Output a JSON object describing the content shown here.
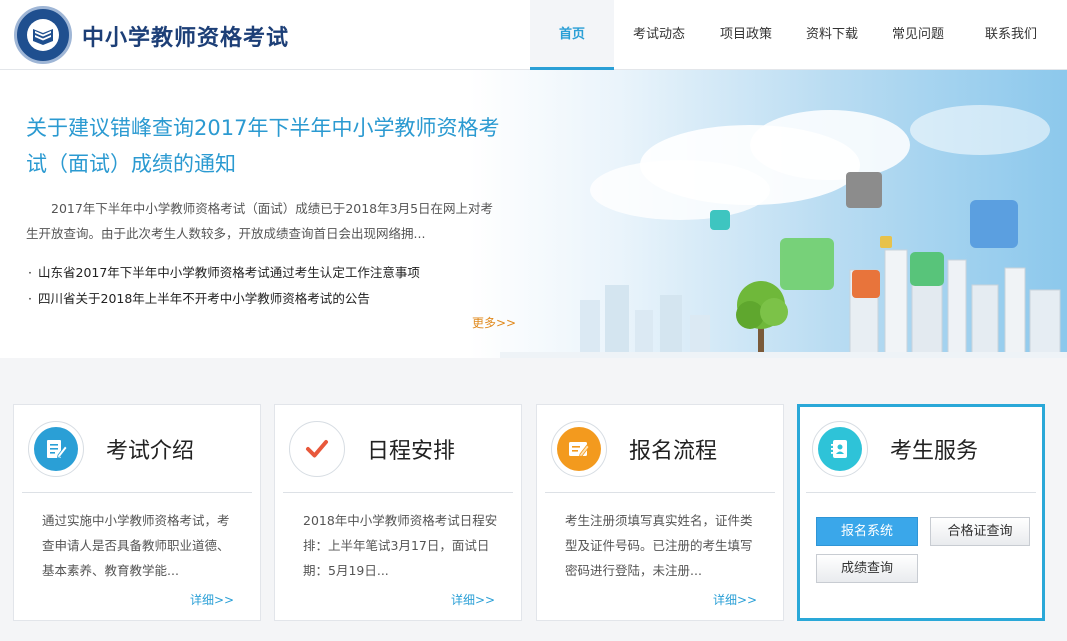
{
  "header": {
    "site_title": "中小学教师资格考试",
    "nav": [
      "首页",
      "考试动态",
      "项目政策",
      "资料下载",
      "常见问题",
      "联系我们"
    ],
    "active_nav": "首页"
  },
  "banner": {
    "headline": "关于建议错峰查询2017年下半年中小学教师资格考试（面试）成绩的通知",
    "summary": "2017年下半年中小学教师资格考试（面试）成绩已于2018年3月5日在网上对考生开放查询。由于此次考生人数较多，开放成绩查询首日会出现网络拥...",
    "news": [
      "山东省2017年下半年中小学教师资格考试通过考生认定工作注意事项",
      "四川省关于2018年上半年不开考中小学教师资格考试的公告"
    ],
    "more_label": "更多>>"
  },
  "cards": [
    {
      "title": "考试介绍",
      "desc": "通过实施中小学教师资格考试，考查申请人是否具备教师职业道德、基本素养、教育教学能...",
      "more": "详细>>",
      "icon": "document-edit-icon"
    },
    {
      "title": "日程安排",
      "desc": "2018年中小学教师资格考试日程安排：上半年笔试3月17日，面试日期：5月19日...",
      "more": "详细>>",
      "icon": "checkmark-icon"
    },
    {
      "title": "报名流程",
      "desc": "考生注册须填写真实姓名，证件类型及证件号码。已注册的考生填写密码进行登陆，未注册...",
      "more": "详细>>",
      "icon": "form-fill-icon"
    }
  ],
  "service": {
    "title": "考生服务",
    "icon": "contact-book-icon",
    "buttons": [
      "报名系统",
      "合格证查询",
      "成绩查询"
    ]
  },
  "colors": {
    "brand_blue": "#2a9fd6",
    "title_navy": "#1d3f77",
    "more_orange": "#e08a1e",
    "primary_button": "#3aa7ea"
  }
}
